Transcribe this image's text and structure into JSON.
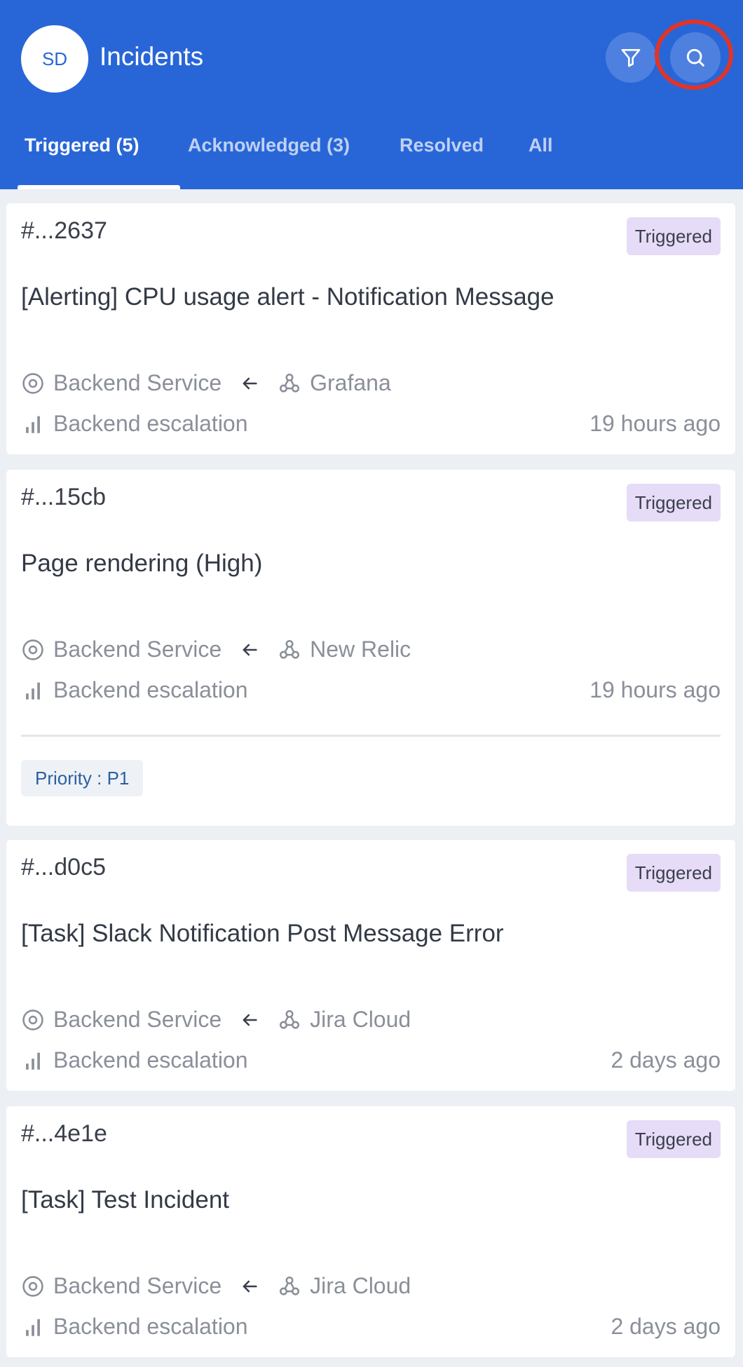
{
  "header": {
    "avatar_initials": "SD",
    "title": "Incidents",
    "filter_icon": "filter-icon",
    "search_icon": "search-icon",
    "accent_color": "#2866d8"
  },
  "tabs": [
    {
      "label": "Triggered (5)",
      "active": true
    },
    {
      "label": "Acknowledged (3)",
      "active": false
    },
    {
      "label": "Resolved",
      "active": false
    },
    {
      "label": "All",
      "active": false
    }
  ],
  "incidents": [
    {
      "id": "#...2637",
      "status": "Triggered",
      "title": "[Alerting] CPU usage alert - Notification Message",
      "service": "Backend Service",
      "source": "Grafana",
      "escalation": "Backend escalation",
      "time": "19 hours ago"
    },
    {
      "id": "#...15cb",
      "status": "Triggered",
      "title": "Page rendering (High)",
      "service": "Backend Service",
      "source": "New Relic",
      "escalation": "Backend escalation",
      "time": "19 hours ago",
      "priority": "Priority : P1"
    },
    {
      "id": "#...d0c5",
      "status": "Triggered",
      "title": "[Task] Slack Notification Post Message Error",
      "service": "Backend Service",
      "source": "Jira Cloud",
      "escalation": "Backend escalation",
      "time": "2 days ago"
    },
    {
      "id": "#...4e1e",
      "status": "Triggered",
      "title": "[Task] Test Incident",
      "service": "Backend Service",
      "source": "Jira Cloud",
      "escalation": "Backend escalation",
      "time": "2 days ago"
    }
  ]
}
